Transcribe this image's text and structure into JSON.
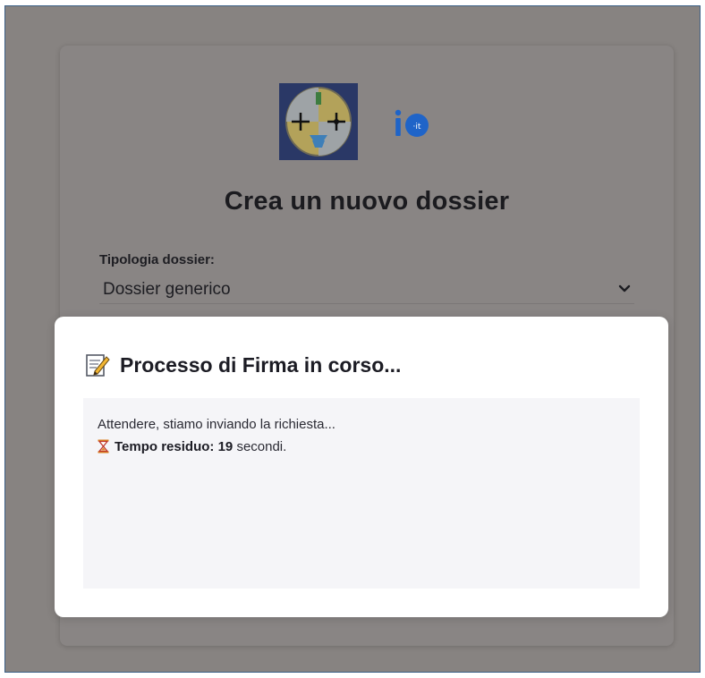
{
  "page": {
    "title": "Crea un nuovo dossier",
    "field": {
      "label": "Tipologia dossier:",
      "value": "Dossier generico"
    }
  },
  "modal": {
    "icon": "memo-icon",
    "title": "Processo di Firma in corso...",
    "message": "Attendere, stiamo inviando la richiesta...",
    "countdown": {
      "icon": "hourglass-icon",
      "label": "Tempo residuo:",
      "seconds": "19",
      "unit": "secondi."
    }
  },
  "logos": [
    "region-calabria-logo",
    "io-it-logo"
  ],
  "colors": {
    "overlay": "#878381",
    "modal_background": "#ffffff",
    "modal_body_background": "#f5f5f8",
    "io_brand": "#1f64c8",
    "region_logo_background": "#1f2f5c"
  }
}
